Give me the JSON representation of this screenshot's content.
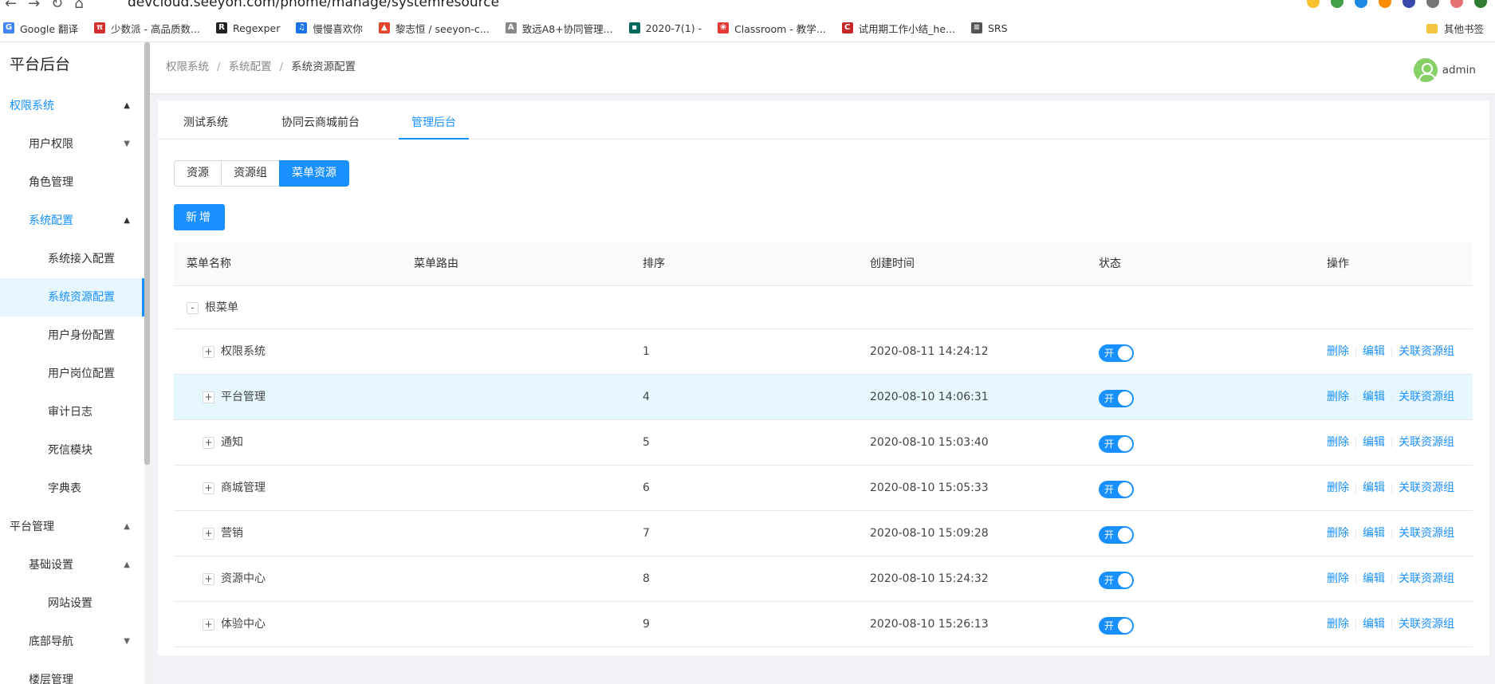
{
  "browser": {
    "url": "devcloud.seeyon.com/phome/manage/systemresource",
    "bookmarks": [
      {
        "label": "Google 翻译",
        "color": "#4285f4",
        "glyph": "G"
      },
      {
        "label": "少数派 - 高品质数...",
        "color": "#d32f2f",
        "glyph": "π"
      },
      {
        "label": "Regexper",
        "color": "#222222",
        "glyph": "R"
      },
      {
        "label": "慢慢喜欢你",
        "color": "#1a73e8",
        "glyph": "♫"
      },
      {
        "label": "黎志恒 / seeyon-c...",
        "color": "#e24329",
        "glyph": "▲"
      },
      {
        "label": "致远A8+协同管理...",
        "color": "#888888",
        "glyph": "A"
      },
      {
        "label": "2020-7(1) -",
        "color": "#00695c",
        "glyph": "▪"
      },
      {
        "label": "Classroom - 教学...",
        "color": "#e53935",
        "glyph": "❀"
      },
      {
        "label": "试用期工作小结_he...",
        "color": "#c62828",
        "glyph": "C"
      },
      {
        "label": "SRS",
        "color": "#555555",
        "glyph": "≡"
      }
    ],
    "other_bookmarks": "其他书签"
  },
  "sidebar": {
    "brand": "平台后台",
    "items": [
      {
        "label": "权限系统",
        "level": 1,
        "state": "active-text",
        "chevron": "▲"
      },
      {
        "label": "用户权限",
        "level": 2,
        "state": "",
        "chevron": "▼"
      },
      {
        "label": "角色管理",
        "level": 2,
        "state": "",
        "chevron": ""
      },
      {
        "label": "系统配置",
        "level": 2,
        "state": "active-text",
        "chevron": "▲"
      },
      {
        "label": "系统接入配置",
        "level": 3,
        "state": "",
        "chevron": ""
      },
      {
        "label": "系统资源配置",
        "level": 3,
        "state": "selected",
        "chevron": ""
      },
      {
        "label": "用户身份配置",
        "level": 3,
        "state": "",
        "chevron": ""
      },
      {
        "label": "用户岗位配置",
        "level": 3,
        "state": "",
        "chevron": ""
      },
      {
        "label": "审计日志",
        "level": 3,
        "state": "",
        "chevron": ""
      },
      {
        "label": "死信模块",
        "level": 3,
        "state": "",
        "chevron": ""
      },
      {
        "label": "字典表",
        "level": 3,
        "state": "",
        "chevron": ""
      },
      {
        "label": "平台管理",
        "level": 1,
        "state": "",
        "chevron": "▲"
      },
      {
        "label": "基础设置",
        "level": 2,
        "state": "",
        "chevron": "▲"
      },
      {
        "label": "网站设置",
        "level": 3,
        "state": "",
        "chevron": ""
      },
      {
        "label": "底部导航",
        "level": 2,
        "state": "",
        "chevron": "▼"
      },
      {
        "label": "楼层管理",
        "level": 2,
        "state": "",
        "chevron": ""
      }
    ]
  },
  "header": {
    "breadcrumb": [
      "权限系统",
      "系统配置",
      "系统资源配置"
    ],
    "username": "admin"
  },
  "tabs": [
    "测试系统",
    "协同云商城前台",
    "管理后台"
  ],
  "active_tab": 2,
  "radio_group": [
    "资源",
    "资源组",
    "菜单资源"
  ],
  "active_radio": 2,
  "add_button": "新增",
  "table": {
    "columns": [
      "菜单名称",
      "菜单路由",
      "排序",
      "创建时间",
      "状态",
      "操作"
    ],
    "root_label": "根菜单",
    "root_expander": "-",
    "child_expander": "+",
    "switch_label": "开",
    "actions": [
      "删除",
      "编辑",
      "关联资源组"
    ],
    "rows": [
      {
        "name": "权限系统",
        "route": "",
        "order": "1",
        "created": "2020-08-11 14:24:12",
        "enabled": true
      },
      {
        "name": "平台管理",
        "route": "",
        "order": "4",
        "created": "2020-08-10 14:06:31",
        "enabled": true
      },
      {
        "name": "通知",
        "route": "",
        "order": "5",
        "created": "2020-08-10 15:03:40",
        "enabled": true
      },
      {
        "name": "商城管理",
        "route": "",
        "order": "6",
        "created": "2020-08-10 15:05:33",
        "enabled": true
      },
      {
        "name": "营销",
        "route": "",
        "order": "7",
        "created": "2020-08-10 15:09:28",
        "enabled": true
      },
      {
        "name": "资源中心",
        "route": "",
        "order": "8",
        "created": "2020-08-10 15:24:32",
        "enabled": true
      },
      {
        "name": "体验中心",
        "route": "",
        "order": "9",
        "created": "2020-08-10 15:26:13",
        "enabled": true
      }
    ]
  },
  "colors": {
    "accent": "#1890ff",
    "selected_bg": "#e6f7ff",
    "avatar": "#87d068"
  }
}
